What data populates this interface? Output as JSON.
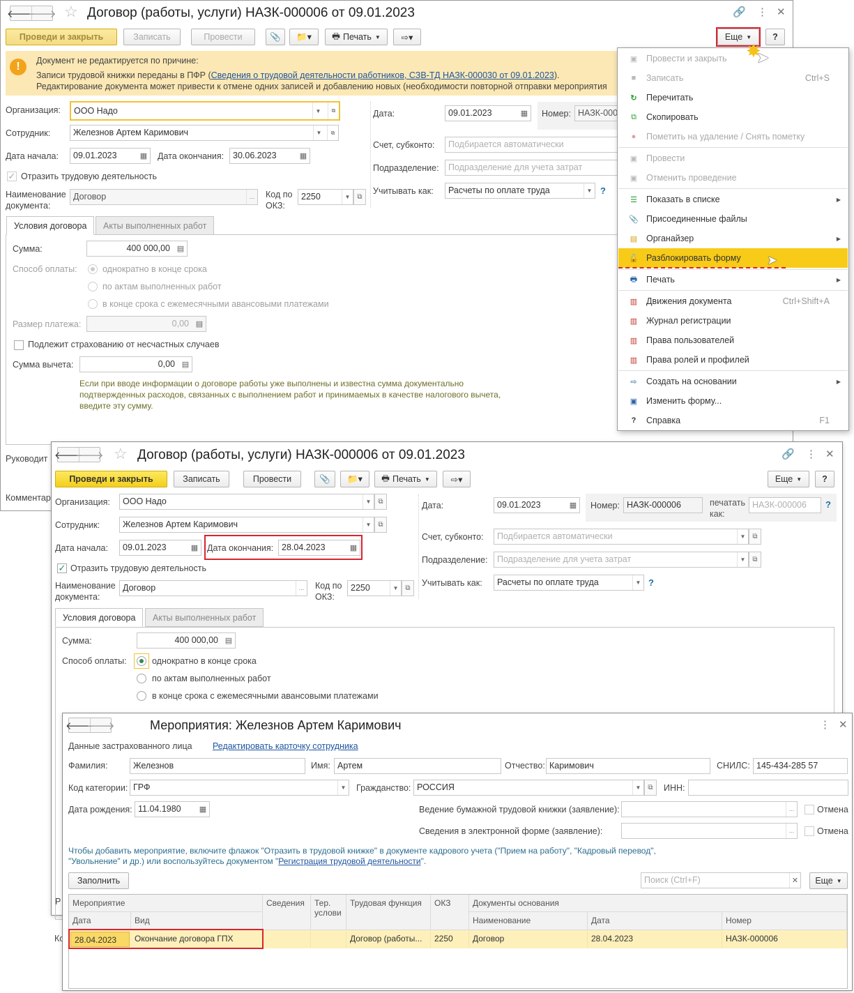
{
  "doc": {
    "title": "Договор (работы, услуги) НАЗК-000006 от 09.01.2023",
    "toolbar": {
      "post_close": "Проведи и закрыть",
      "save": "Записать",
      "post": "Провести",
      "print": "Печать",
      "more": "Еще",
      "help": "?"
    },
    "banner": {
      "line1": "Документ не редактируется по причине:",
      "line2_pre": "Записи трудовой книжки переданы в ПФР (",
      "line2_link": "Сведения о трудовой деятельности работников, СЗВ-ТД НАЗК-000030 от 09.01.2023",
      "line2_post": ").",
      "line3": "Редактирование документа может привести к отмене одних записей и добавлению новых (необходимости повторной отправки мероприятия"
    },
    "labels": {
      "org": "Организация:",
      "employee": "Сотрудник:",
      "start": "Дата начала:",
      "end": "Дата окончания:",
      "reflect": "Отразить трудовую деятельность",
      "docname1": "Наименование",
      "docname2": "документа:",
      "okz1": "Код по",
      "okz2": "ОКЗ:",
      "date": "Дата:",
      "number": "Номер:",
      "account": "Счет, субконто:",
      "dept": "Подразделение:",
      "consider": "Учитывать как:",
      "print_as1": "печатать",
      "print_as2": "как:"
    },
    "values": {
      "org": "ООО Надо",
      "employee": "Железнов Артем Каримович",
      "start": "09.01.2023",
      "end": "30.06.2023",
      "docname": "Договор",
      "okz": "2250",
      "date": "09.01.2023",
      "number": "НАЗК-000006",
      "account_ph": "Подбирается автоматически",
      "dept_ph": "Подразделение для учета затрат",
      "consider": "Расчеты по оплате труда"
    },
    "tabs": [
      "Условия договора",
      "Акты выполненных работ"
    ],
    "terms": {
      "sum_label": "Сумма:",
      "sum": "400 000,00",
      "pay_label": "Способ оплаты:",
      "pay1": "однократно в конце срока",
      "pay2": "по актам выполненных работ",
      "pay3": "в конце срока с ежемесячными авансовыми платежами",
      "payment_label": "Размер платежа:",
      "payment": "0,00",
      "insurance": "Подлежит страхованию от несчастных случаев",
      "deduct_label": "Сумма вычета:",
      "deduct": "0,00",
      "hint1": "Если при вводе информации о договоре работы уже выполнены и известна сумма документально",
      "hint2": "подтвержденных расходов, связанных с выполнением работ и принимаемых в качестве налогового вычета,",
      "hint3": "введите эту сумму."
    },
    "cut_labels": {
      "manager": "Руководит",
      "comment": "Комментар",
      "r": "Р",
      "k": "Ко"
    }
  },
  "menu": {
    "items": [
      {
        "label": "Провести и закрыть",
        "shortcut": "",
        "icon": "post-close-icon",
        "disabled": true
      },
      {
        "label": "Записать",
        "shortcut": "Ctrl+S",
        "icon": "save-icon",
        "disabled": true
      },
      {
        "label": "Перечитать",
        "shortcut": "",
        "icon": "refresh-icon",
        "disabled": false
      },
      {
        "label": "Скопировать",
        "shortcut": "",
        "icon": "copy-icon",
        "disabled": false
      },
      {
        "label": "Пометить на удаление / Снять пометку",
        "shortcut": "",
        "icon": "delete-mark-icon",
        "disabled": true
      },
      {
        "label": "Провести",
        "shortcut": "",
        "icon": "post-icon",
        "disabled": true
      },
      {
        "label": "Отменить проведение",
        "shortcut": "",
        "icon": "unpost-icon",
        "disabled": true
      },
      {
        "label": "Показать в списке",
        "shortcut": "",
        "icon": "list-icon",
        "disabled": false
      },
      {
        "label": "Присоединенные файлы",
        "shortcut": "",
        "icon": "paperclip-icon",
        "disabled": false
      },
      {
        "label": "Органайзер",
        "shortcut": "",
        "icon": "organizer-icon",
        "disabled": false
      },
      {
        "label": "Разблокировать форму",
        "shortcut": "",
        "icon": "unlock-icon",
        "disabled": false
      },
      {
        "label": "Печать",
        "shortcut": "",
        "icon": "printer-icon",
        "disabled": false
      },
      {
        "label": "Движения документа",
        "shortcut": "Ctrl+Shift+A",
        "icon": "movements-icon",
        "disabled": false
      },
      {
        "label": "Журнал регистрации",
        "shortcut": "",
        "icon": "log-icon",
        "disabled": false
      },
      {
        "label": "Права пользователей",
        "shortcut": "",
        "icon": "rights-icon",
        "disabled": false
      },
      {
        "label": "Права ролей и профилей",
        "shortcut": "",
        "icon": "roles-icon",
        "disabled": false
      },
      {
        "label": "Создать на основании",
        "shortcut": "",
        "icon": "create-based-icon",
        "disabled": false
      },
      {
        "label": "Изменить форму...",
        "shortcut": "",
        "icon": "form-settings-icon",
        "disabled": false
      },
      {
        "label": "Справка",
        "shortcut": "F1",
        "icon": "help-icon",
        "disabled": false
      }
    ]
  },
  "doc2": {
    "values": {
      "end": "28.04.2023",
      "number": "НАЗК-000006",
      "print_as": "НАЗК-000006"
    }
  },
  "events": {
    "title": "Мероприятия: Железнов Артем Каримович",
    "insured_label": "Данные застрахованного лица",
    "edit_link": "Редактировать карточку сотрудника",
    "labels": {
      "surname": "Фамилия:",
      "name": "Имя:",
      "patronymic": "Отчество:",
      "snils": "СНИЛС:",
      "category": "Код категории:",
      "citizenship": "Гражданство:",
      "inn": "ИНН:",
      "birth": "Дата рождения:",
      "paper": "Ведение бумажной трудовой книжки (заявление):",
      "electronic": "Сведения в электронной форме (заявление):",
      "cancel": "Отмена"
    },
    "values": {
      "surname": "Железнов",
      "name": "Артем",
      "patronymic": "Каримович",
      "snils": "145-434-285 57",
      "category": "ГРФ",
      "citizenship": "РОССИЯ",
      "birth": "11.04.1980"
    },
    "hint1": "Чтобы добавить мероприятие, включите флажок \"Отразить в трудовой книжке\" в документе кадрового учета (\"Прием на работу\", \"Кадровый перевод\",",
    "hint2_pre": "\"Увольнение\" и др.) или воспользуйтесь документом \"",
    "hint2_link": "Регистрация трудовой деятельности",
    "hint2_post": "\".",
    "fill": "Заполнить",
    "search_ph": "Поиск (Ctrl+F)",
    "more": "Еще",
    "headers": {
      "event": "Мероприятие",
      "date": "Дата",
      "kind": "Вид",
      "info": "Сведения",
      "ter1": "Тер.",
      "ter2": "услови",
      "labor": "Трудовая функция",
      "okz": "ОКЗ",
      "basis": "Документы основания",
      "bname": "Наименование",
      "bdate": "Дата",
      "bnum": "Номер"
    },
    "row": {
      "date": "28.04.2023",
      "kind": "Окончание договора ГПХ",
      "labor": "Договор (работы...",
      "okz": "2250",
      "bname": "Договор",
      "bdate": "28.04.2023",
      "bnum": "НАЗК-000006"
    }
  }
}
